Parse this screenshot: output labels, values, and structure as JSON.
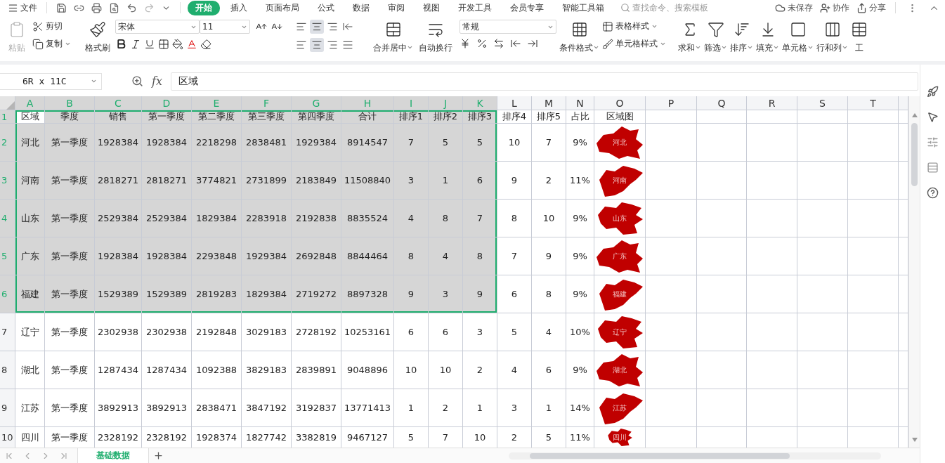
{
  "menu_bar": {
    "file": "文件",
    "tabs": [
      {
        "label": "开始",
        "selected": true
      },
      {
        "label": "插入",
        "selected": false
      },
      {
        "label": "页面布局",
        "selected": false
      },
      {
        "label": "公式",
        "selected": false
      },
      {
        "label": "数据",
        "selected": false
      },
      {
        "label": "审阅",
        "selected": false
      },
      {
        "label": "视图",
        "selected": false
      },
      {
        "label": "开发工具",
        "selected": false
      },
      {
        "label": "会员专享",
        "selected": false
      },
      {
        "label": "智能工具箱",
        "selected": false
      }
    ],
    "search": {
      "placeholder": "查找命令、搜索模板"
    },
    "actions": [
      {
        "kind": "cloud",
        "label": "未保存"
      },
      {
        "kind": "collab",
        "label": "协作"
      },
      {
        "kind": "share",
        "label": "分享"
      }
    ]
  },
  "ribbon": {
    "paste": "粘贴",
    "cut": "剪切",
    "copy": "复制",
    "painter": "格式刷",
    "font_name": "宋体",
    "font_size": "11",
    "number_format": "常规",
    "big_buttons": [
      {
        "kind": "merge",
        "label": "合并居中",
        "dropdown": true
      },
      {
        "kind": "wrap",
        "label": "自动换行",
        "dropdown": false
      }
    ],
    "style_buttons": [
      {
        "kind": "conditional",
        "label": "条件格式",
        "dropdown": true
      }
    ],
    "small_buttons": [
      {
        "kind": "table-style",
        "label": "表格样式",
        "dropdown": true
      },
      {
        "kind": "cell-style",
        "label": "单元格样式",
        "dropdown": true
      }
    ],
    "tool_buttons": [
      {
        "kind": "sum",
        "label": "求和",
        "dropdown": true
      },
      {
        "kind": "filter",
        "label": "筛选",
        "dropdown": true
      },
      {
        "kind": "sort",
        "label": "排序",
        "dropdown": true
      },
      {
        "kind": "fill",
        "label": "填充",
        "dropdown": true
      },
      {
        "kind": "cell",
        "label": "单元格",
        "dropdown": true
      },
      {
        "kind": "rowcol",
        "label": "行和列",
        "dropdown": true
      },
      {
        "kind": "sheet",
        "label": "工",
        "dropdown": false
      }
    ]
  },
  "formula_bar": {
    "name_box": "6R x 11C",
    "fx": "fx",
    "formula": "区域"
  },
  "sheet": {
    "columns": [
      {
        "label": "A",
        "selected": true
      },
      {
        "label": "B",
        "selected": true
      },
      {
        "label": "C",
        "selected": true
      },
      {
        "label": "D",
        "selected": true
      },
      {
        "label": "E",
        "selected": true
      },
      {
        "label": "F",
        "selected": true
      },
      {
        "label": "G",
        "selected": true
      },
      {
        "label": "H",
        "selected": true
      },
      {
        "label": "I",
        "selected": true
      },
      {
        "label": "J",
        "selected": true
      },
      {
        "label": "K",
        "selected": true
      },
      {
        "label": "L",
        "selected": false
      },
      {
        "label": "M",
        "selected": false
      },
      {
        "label": "N",
        "selected": false
      },
      {
        "label": "O",
        "selected": false
      },
      {
        "label": "P",
        "selected": false
      },
      {
        "label": "Q",
        "selected": false
      },
      {
        "label": "R",
        "selected": false
      },
      {
        "label": "S",
        "selected": false
      },
      {
        "label": "T",
        "selected": false
      }
    ],
    "rows": [
      {
        "header": "1",
        "selected": true,
        "cells": [
          "区域",
          "季度",
          "销售",
          "第一季度",
          "第二季度",
          "第三季度",
          "第四季度",
          "合计",
          "排序1",
          "排序2",
          "排序3",
          "排序4",
          "排序5",
          "占比",
          "区域图"
        ]
      },
      {
        "header": "2",
        "selected": true,
        "cells": [
          "河北",
          "第一季度",
          "1928384",
          "1928384",
          "2218298",
          "2838481",
          "1929384",
          "8914547",
          "7",
          "5",
          "5",
          "10",
          "7",
          "9%"
        ],
        "map_label": "河北"
      },
      {
        "header": "3",
        "selected": true,
        "cells": [
          "河南",
          "第一季度",
          "2818271",
          "2818271",
          "3774821",
          "2731899",
          "2183849",
          "11508840",
          "3",
          "1",
          "6",
          "9",
          "2",
          "11%"
        ],
        "map_label": "河南"
      },
      {
        "header": "4",
        "selected": true,
        "cells": [
          "山东",
          "第一季度",
          "2529384",
          "2529384",
          "1829384",
          "2283918",
          "2192838",
          "8835524",
          "4",
          "8",
          "7",
          "8",
          "10",
          "9%"
        ],
        "map_label": "山东"
      },
      {
        "header": "5",
        "selected": true,
        "cells": [
          "广东",
          "第一季度",
          "1928384",
          "1928384",
          "2293848",
          "1929384",
          "2692848",
          "8844464",
          "8",
          "4",
          "8",
          "7",
          "9",
          "9%"
        ],
        "map_label": "广东"
      },
      {
        "header": "6",
        "selected": true,
        "cells": [
          "福建",
          "第一季度",
          "1529389",
          "1529389",
          "2819283",
          "1829384",
          "2719272",
          "8897328",
          "9",
          "3",
          "9",
          "6",
          "8",
          "9%"
        ],
        "map_label": "福建"
      },
      {
        "header": "7",
        "selected": false,
        "cells": [
          "辽宁",
          "第一季度",
          "2302938",
          "2302938",
          "2192848",
          "3029183",
          "2728192",
          "10253161",
          "6",
          "6",
          "3",
          "5",
          "4",
          "10%"
        ],
        "map_label": "辽宁"
      },
      {
        "header": "8",
        "selected": false,
        "cells": [
          "湖北",
          "第一季度",
          "1287434",
          "1287434",
          "1092388",
          "3829183",
          "2839891",
          "9048896",
          "10",
          "10",
          "2",
          "4",
          "6",
          "9%"
        ],
        "map_label": "湖北"
      },
      {
        "header": "9",
        "selected": false,
        "cells": [
          "江苏",
          "第一季度",
          "3892913",
          "3892913",
          "2838471",
          "3847192",
          "3192837",
          "13771413",
          "1",
          "2",
          "1",
          "3",
          "1",
          "14%"
        ],
        "map_label": "江苏"
      },
      {
        "header": "10",
        "selected": false,
        "cells": [
          "四川",
          "第一季度",
          "2328192",
          "2328192",
          "1928374",
          "1827742",
          "3382819",
          "9467127",
          "5",
          "7",
          "10",
          "2",
          "5",
          "11%"
        ],
        "map_label": "四川"
      }
    ]
  },
  "sheet_tabs": [
    {
      "label": "基础数据",
      "selected": true
    }
  ]
}
